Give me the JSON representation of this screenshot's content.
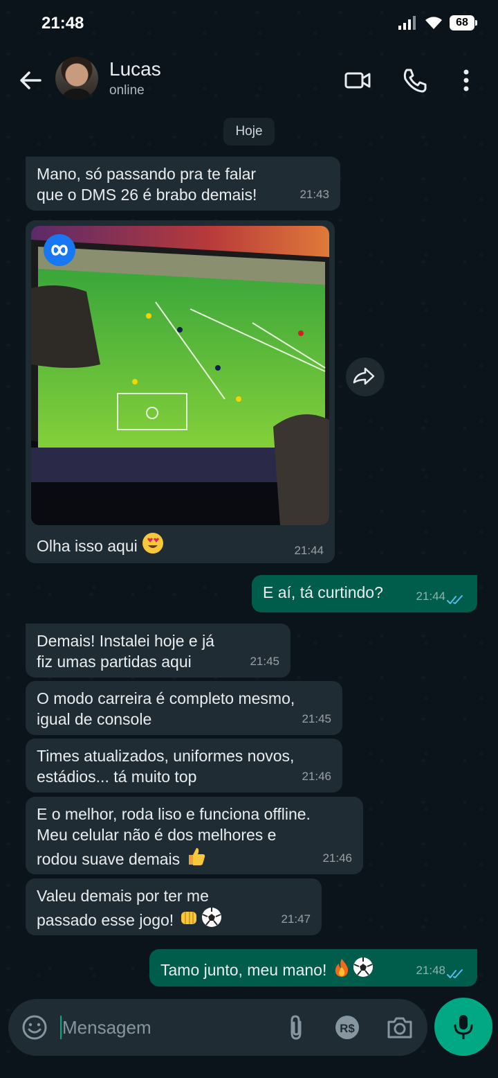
{
  "status_bar": {
    "time": "21:48",
    "battery": "68"
  },
  "header": {
    "contact_name": "Lucas",
    "contact_status": "online"
  },
  "chat": {
    "day_label": "Hoje",
    "messages": [
      {
        "text": "Mano, só passando pra te falar\nque o DMS 26 é brabo demais!",
        "time": "21:43"
      },
      {
        "caption": "Olha isso aqui",
        "time": "21:44"
      },
      {
        "text": "E aí, tá curtindo?",
        "time": "21:44"
      },
      {
        "text": "Demais! Instalei hoje e já\nfiz umas partidas aqui",
        "time": "21:45"
      },
      {
        "text": "O modo carreira é completo mesmo,\nigual de console",
        "time": "21:45"
      },
      {
        "text": "Times atualizados, uniformes novos,\nestádios... tá muito top",
        "time": "21:46"
      },
      {
        "text": "E o melhor, roda liso e funciona offline.\nMeu celular não é dos melhores e\nrodou suave demais",
        "time": "21:46"
      },
      {
        "text": "Valeu demais por ter me\npassado esse jogo!",
        "time": "21:47"
      },
      {
        "text": "Tamo junto, meu mano!",
        "time": "21:48"
      }
    ]
  },
  "input": {
    "placeholder": "Mensagem"
  },
  "colors": {
    "background": "#0b141a",
    "incoming": "#202c33",
    "outgoing": "#005c4b",
    "accent": "#00a884",
    "read_ticks": "#53bdeb"
  },
  "icons": [
    "back-arrow-icon",
    "video-call-icon",
    "phone-icon",
    "more-vert-icon",
    "forward-icon",
    "emoji-icon",
    "attach-icon",
    "payment-icon",
    "camera-icon",
    "mic-icon"
  ]
}
